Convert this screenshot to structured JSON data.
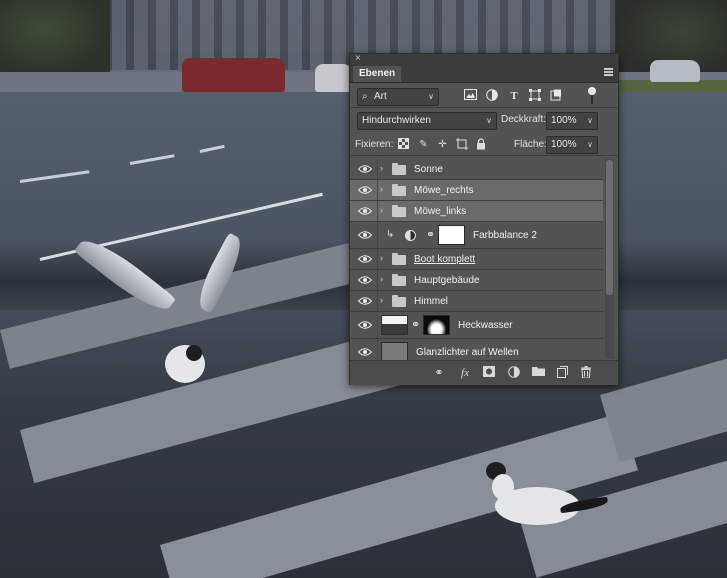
{
  "panel": {
    "close_glyph": "×",
    "tab_label": "Ebenen",
    "menu_icon": "panel-menu-icon"
  },
  "filter": {
    "kind_label": "Art",
    "icons": [
      "image-filter-icon",
      "adjustment-filter-icon",
      "type-filter-icon",
      "shape-filter-icon",
      "smart-object-filter-icon"
    ]
  },
  "blend": {
    "mode": "Hindurchwirken",
    "opacity_label": "Deckkraft:",
    "opacity_value": "100%"
  },
  "lock": {
    "label": "Fixieren:",
    "fill_label": "Fläche:",
    "fill_value": "100%"
  },
  "layers": [
    {
      "name": "Sonne",
      "kind": "group",
      "selected": false
    },
    {
      "name": "Möwe_rechts",
      "kind": "group",
      "selected": true
    },
    {
      "name": "Möwe_links",
      "kind": "group",
      "selected": true
    },
    {
      "name": "Farbbalance 2",
      "kind": "adjustment",
      "selected": false
    },
    {
      "name": "Boot komplett",
      "kind": "group",
      "selected": false
    },
    {
      "name": "Hauptgebäude",
      "kind": "group",
      "selected": false
    },
    {
      "name": "Himmel",
      "kind": "group",
      "selected": false
    },
    {
      "name": "Heckwasser",
      "kind": "image-with-mask",
      "selected": false
    },
    {
      "name": "Glanzlichter auf Wellen",
      "kind": "image",
      "selected": false
    }
  ],
  "bottom_icons": [
    "link-layers-icon",
    "fx-icon",
    "add-mask-icon",
    "new-adjustment-icon",
    "new-group-icon",
    "new-layer-icon",
    "trash-icon"
  ],
  "colors": {
    "panel_bg": "#535353",
    "panel_header": "#3c3c3c",
    "selected_row": "#6a6a6a"
  }
}
